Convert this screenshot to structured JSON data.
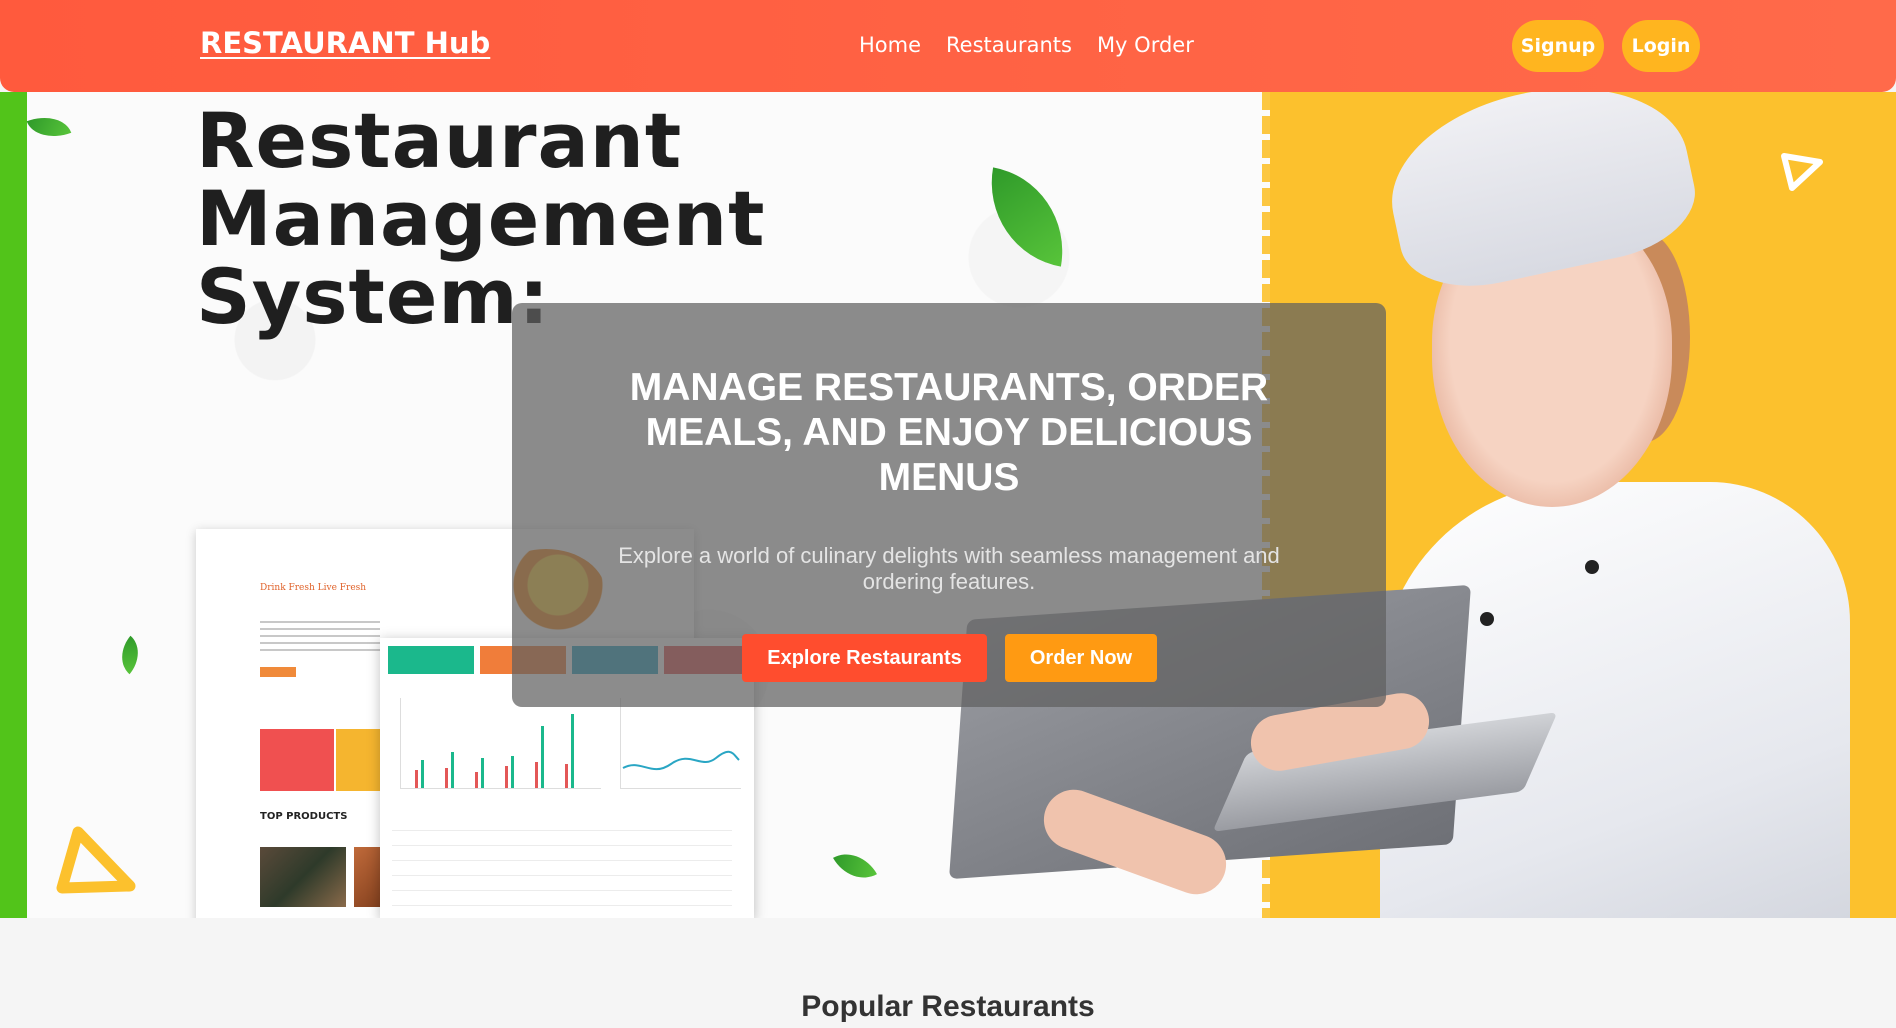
{
  "navbar": {
    "brand": "RESTAURANT Hub",
    "links": [
      "Home",
      "Restaurants",
      "My Order"
    ],
    "signup_label": "Signup",
    "login_label": "Login",
    "background_color": "#ff5a3d",
    "button_color": "#ffb51f"
  },
  "hero": {
    "banner_title": "Restaurant\nManagement\nSystem:",
    "overlay": {
      "heading": "MANAGE RESTAURANTS, ORDER MEALS, AND ENJOY DELICIOUS MENUS",
      "subtext": "Explore a world of culinary delights with seamless management and ordering features.",
      "explore_label": "Explore Restaurants",
      "order_label": "Order Now"
    },
    "mockup": {
      "tagline": "Drink Fresh Live Fresh",
      "products_label": "TOP PRODUCTS"
    },
    "accent_colors": {
      "green_stripe": "#52c41a",
      "yellow_panel": "#fcc12d",
      "explore_button": "#ff4d2e",
      "order_button": "#ff9a12"
    }
  },
  "popular": {
    "heading": "Popular Restaurants"
  }
}
